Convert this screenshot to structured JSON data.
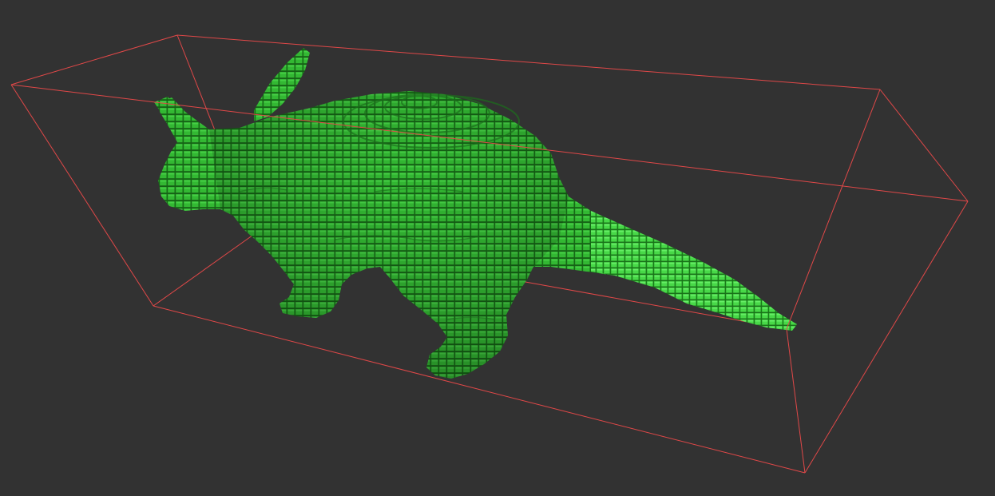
{
  "viewer": {
    "background_color": "#323232",
    "bbox_color": "#e04848",
    "model_color": "#2fb52f",
    "model_highlight_color": "#4ee04e",
    "model_shadow_color": "#145a14",
    "view": "3d-perspective"
  }
}
